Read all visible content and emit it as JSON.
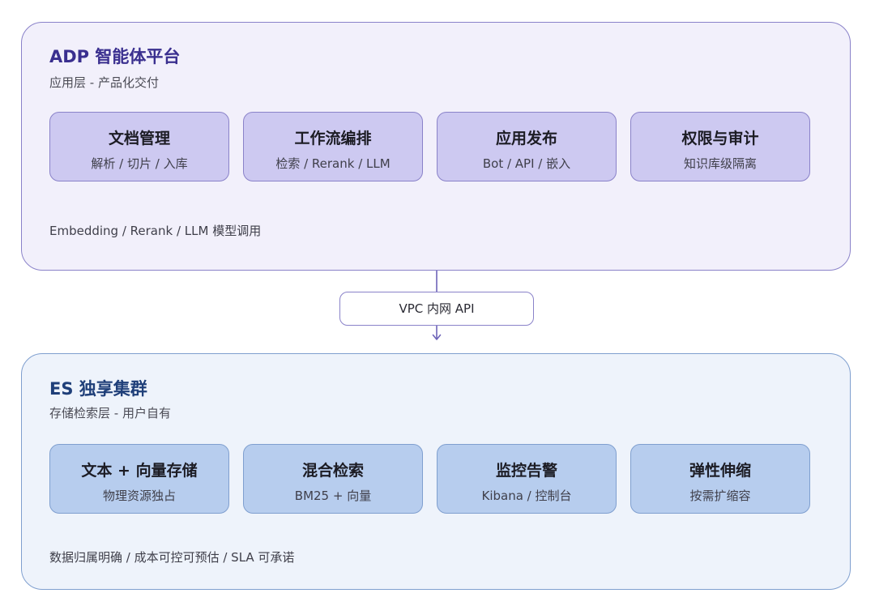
{
  "diagram": {
    "top_panel": {
      "title": "ADP 智能体平台",
      "subtitle": "应用层 - 产品化交付",
      "cards": [
        {
          "title": "文档管理",
          "subtitle": "解析 / 切片 / 入库"
        },
        {
          "title": "工作流编排",
          "subtitle": "检索 / Rerank / LLM"
        },
        {
          "title": "应用发布",
          "subtitle": "Bot / API / 嵌入"
        },
        {
          "title": "权限与审计",
          "subtitle": "知识库级隔离"
        }
      ],
      "footer": "Embedding / Rerank / LLM 模型调用"
    },
    "link": {
      "label": "VPC 内网 API"
    },
    "bottom_panel": {
      "title": "ES 独享集群",
      "subtitle": "存储检索层 - 用户自有",
      "cards": [
        {
          "title": "文本 + 向量存储",
          "subtitle": "物理资源独占"
        },
        {
          "title": "混合检索",
          "subtitle": "BM25 + 向量"
        },
        {
          "title": "监控告警",
          "subtitle": "Kibana / 控制台"
        },
        {
          "title": "弹性伸缩",
          "subtitle": "按需扩缩容"
        }
      ],
      "footer": "数据归属明确 / 成本可控可预估 / SLA 可承诺"
    }
  },
  "colors": {
    "top_panel_fill": "#f2f0fb",
    "top_panel_border": "#8a82c9",
    "top_card_fill": "#cdc9f1",
    "bottom_panel_fill": "#eef3fb",
    "bottom_panel_border": "#7f9fcf",
    "bottom_card_fill": "#b7cdee",
    "top_title": "#3a2f8f",
    "bottom_title": "#1f3f79"
  }
}
